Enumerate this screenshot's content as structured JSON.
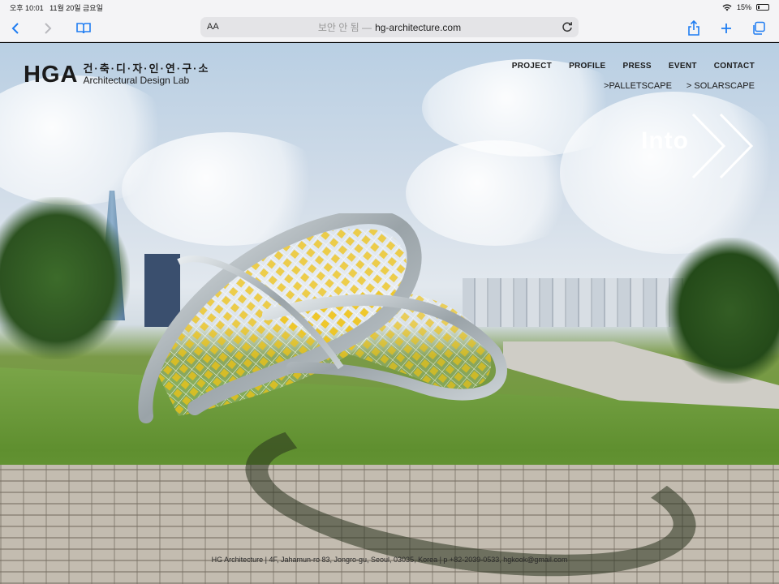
{
  "status_bar": {
    "time": "오후 10:01",
    "date": "11월 20일 금요일",
    "battery": "15%"
  },
  "browser": {
    "text_size_label": "AA",
    "insecure_label": "보안 안 됨 —",
    "url": "hg-architecture.com"
  },
  "site": {
    "logo_mark": "HGA",
    "logo_korean": "건·축·디·자·인·연·구·소",
    "logo_english": "Architectural Design Lab",
    "nav": [
      "PROJECT",
      "PROFILE",
      "PRESS",
      "EVENT",
      "CONTACT"
    ],
    "subnav": [
      ">PALLETSCAPE",
      "> SOLARSCAPE"
    ],
    "into_label": "Into",
    "footer": "HG Architecture | 4F, Jahamun-ro 83, Jongro-gu, Seoul, 03035, Korea | p +82-2039-0533, hgkook@gmail.com"
  },
  "colors": {
    "accent_blue": "#1e7cf2",
    "sculpture_yellow": "#f0c419"
  }
}
